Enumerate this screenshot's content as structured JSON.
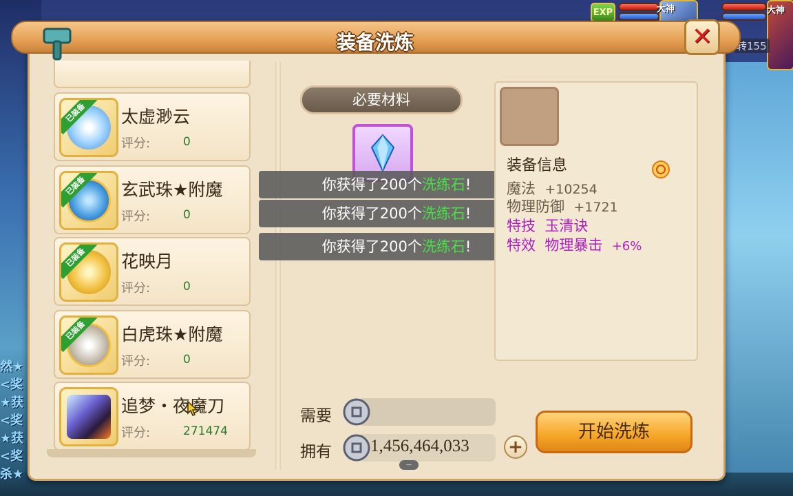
{
  "hud": {
    "exp_label": "EXP",
    "tag_left": "大神",
    "tag_right": "大神",
    "turn_text": "转155"
  },
  "side_texts": [
    "然★",
    "<奖",
    "★获",
    "<奖",
    "★获",
    "<奖",
    "杀★"
  ],
  "dialog": {
    "title": "装备洗炼",
    "close_icon": "close-x-icon",
    "title_icon": "hammer-icon"
  },
  "equipment_list": {
    "items": [
      {
        "name": "太虚渺云",
        "score_label": "评分:",
        "score": "0",
        "equipped_label": "已装备",
        "icon_color": "#9fd4ff"
      },
      {
        "name": "玄武珠★附魔",
        "score_label": "评分:",
        "score": "0",
        "equipped_label": "已装备",
        "icon_color": "#4a9fe0"
      },
      {
        "name": "花映月",
        "score_label": "评分:",
        "score": "0",
        "equipped_label": "已装备",
        "icon_color": "#f2c040"
      },
      {
        "name": "白虎珠★附魔",
        "score_label": "评分:",
        "score": "0",
        "equipped_label": "已装备",
        "icon_color": "#c8c0b0"
      },
      {
        "name": "追梦・夜魔刀",
        "score_label": "评分:",
        "score": "271474",
        "equipped_label": "",
        "icon_color": "#6a60d0"
      }
    ]
  },
  "materials": {
    "banner": "必要材料",
    "item_icon": "crystal-icon",
    "accent_color": "#c050e0"
  },
  "toasts": [
    {
      "prefix": "你获得了200个",
      "highlight": "洗练石",
      "suffix": "!"
    },
    {
      "prefix": "你获得了200个",
      "highlight": "洗练石",
      "suffix": "!"
    },
    {
      "prefix": "你获得了200个",
      "highlight": "洗练石",
      "suffix": "!"
    }
  ],
  "info": {
    "heading": "装备信息",
    "magic_label": "魔法",
    "magic_value": "+10254",
    "pdef_label": "物理防御",
    "pdef_value": "+1721",
    "skill_label": "特技",
    "skill_value": "玉清诀",
    "effect_label": "特效",
    "effect_value": "物理暴击",
    "effect_pct": "+6%"
  },
  "cost": {
    "need_label": "需要",
    "own_label": "拥有",
    "own_value": "1,456,464,033",
    "currency_icon": "silver-coin-icon",
    "plus_label": "+"
  },
  "actions": {
    "start_label": "开始洗炼"
  },
  "colors": {
    "panel_bg": "#efe2c8",
    "title_orange": "#e6a055",
    "highlight_green": "#46e046",
    "purple_text": "#b020c0",
    "score_green": "#2a7a2a"
  }
}
